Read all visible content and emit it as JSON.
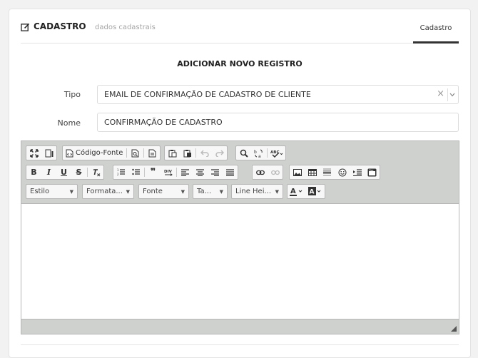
{
  "header": {
    "title": "CADASTRO",
    "subtitle": "dados cadastrais",
    "tab_label": "Cadastro"
  },
  "form": {
    "title": "ADICIONAR NOVO REGISTRO",
    "tipo_label": "Tipo",
    "tipo_value": "EMAIL DE CONFIRMAÇÃO DE CADASTRO DE CLIENTE",
    "nome_label": "Nome",
    "nome_value": "CONFIRMAÇÃO DE CADASTRO"
  },
  "editor": {
    "source_label": "Código-Fonte",
    "combos": {
      "estilo": "Estilo",
      "formatacao": "Formata...",
      "fonte": "Fonte",
      "tamanho": "Ta...",
      "line_height": "Line Hei..."
    }
  },
  "colors": {
    "toolbar_bg": "#cfd1cf",
    "tab_underline": "#333333"
  },
  "icons": [
    "edit-icon",
    "maximize-icon",
    "show-blocks-icon",
    "source-icon",
    "preview-icon",
    "templates-icon",
    "paste-text-icon",
    "paste-word-icon",
    "undo-icon",
    "redo-icon",
    "find-icon",
    "replace-icon",
    "spellcheck-icon",
    "bold-icon",
    "italic-icon",
    "underline-icon",
    "strike-icon",
    "remove-format-icon",
    "numbered-list-icon",
    "bulleted-list-icon",
    "blockquote-icon",
    "bidi-ltr-icon",
    "align-left-icon",
    "align-center-icon",
    "align-right-icon",
    "justify-icon",
    "link-icon",
    "unlink-icon",
    "image-icon",
    "table-icon",
    "horizontal-rule-icon",
    "smiley-icon",
    "indent-icon",
    "youtube-icon",
    "text-color-icon",
    "bg-color-icon",
    "resize-handle-icon"
  ]
}
